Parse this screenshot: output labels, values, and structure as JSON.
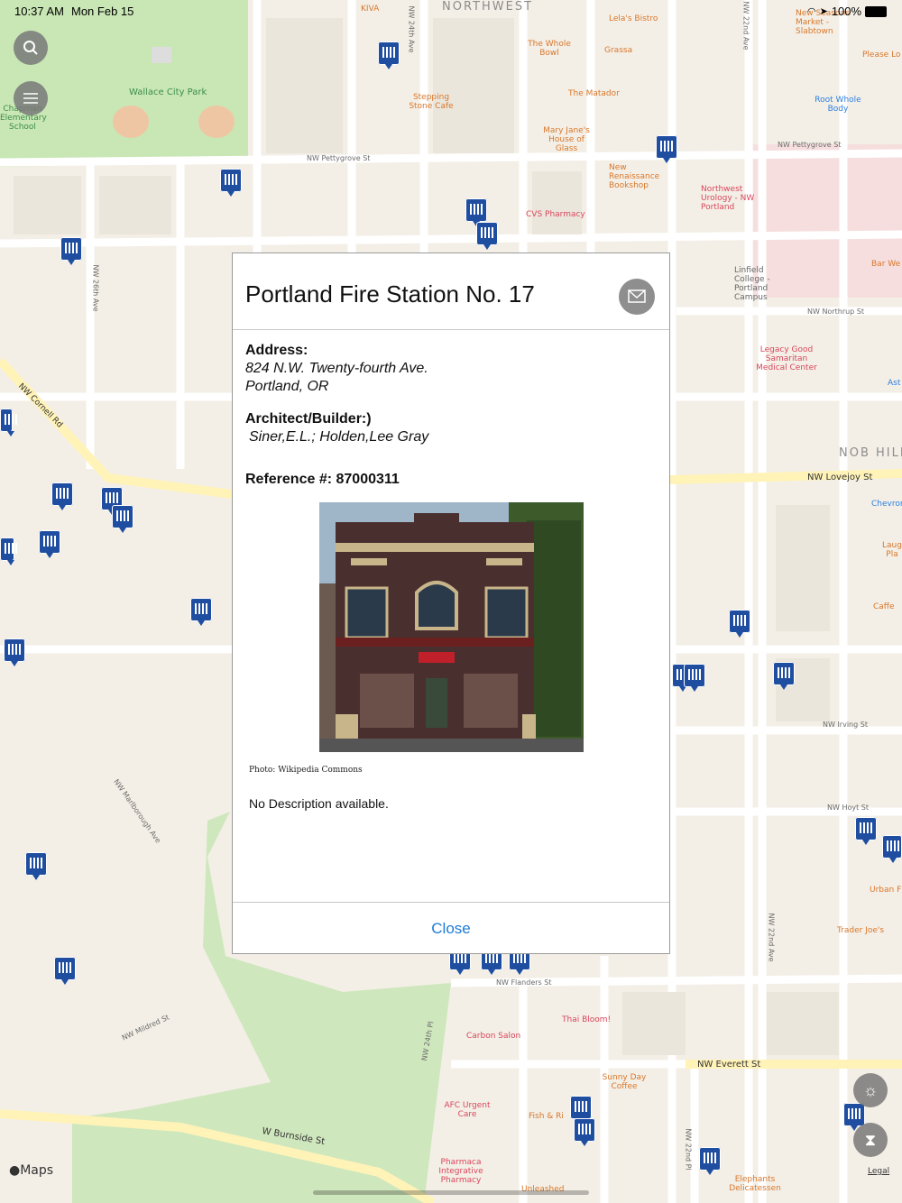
{
  "status_bar": {
    "time": "10:37 AM",
    "date": "Mon Feb 15",
    "battery": "100%"
  },
  "map": {
    "area_labels": [
      "NORTHWEST",
      "NOB HILL"
    ],
    "streets": [
      "NW Pettygrove St",
      "NW Northrup St",
      "NW Lovejoy St",
      "NW Irving St",
      "NW Hoyt St",
      "NW Flanders St",
      "NW Everett St",
      "W Burnside St",
      "NW Cornell Rd",
      "NW 26th Ave",
      "NW 24th Ave",
      "NW 22nd Ave",
      "NW Marlborough Ave",
      "NW Mildred St",
      "NW 24th Pl",
      "NW 22nd Pl"
    ],
    "places": [
      "Wallace City Park",
      "KIVA",
      "Lela's Bistro",
      "The Whole Bowl",
      "Grassa",
      "Stepping Stone Cafe",
      "The Matador",
      "Mary Jane's House of Glass",
      "New Renaissance Bookshop",
      "CVS Pharmacy",
      "Northwest Urology - NW Portland",
      "Root Whole Body",
      "Linfield College - Portland Campus",
      "Legacy Good Samaritan Medical Center",
      "New Seasons Market - Slabtown",
      "Please Lo",
      "Bar We",
      "Chevron",
      "Caffe",
      "Urban F",
      "Trader Joe's",
      "Thai Bloom!",
      "Carbon Salon",
      "Sunny Day Coffee",
      "AFC Urgent Care",
      "Fish & Ri",
      "Pharmaca Integrative Pharmacy",
      "Unleashed",
      "Elephants Delicatessen",
      "Chapman Elementary School",
      "Ast",
      "Laug Pla"
    ]
  },
  "brand": {
    "maps_logo": "Maps",
    "legal": "Legal"
  },
  "modal": {
    "title": "Portland Fire Station No. 17",
    "address_label": "Address:",
    "address_line1": "824 N.W. Twenty-fourth Ave.",
    "address_line2": "Portland, OR",
    "architect_label": "Architect/Builder:)",
    "architect_value": "Siner,E.L.; Holden,Lee Gray",
    "reference": "Reference #: 87000311",
    "photo_credit": "Photo: Wikipedia Commons",
    "description": "No Description available.",
    "close_label": "Close"
  },
  "colors": {
    "pin": "#1f4ea1",
    "link": "#1e7bd6",
    "park": "#c9e6b5"
  }
}
